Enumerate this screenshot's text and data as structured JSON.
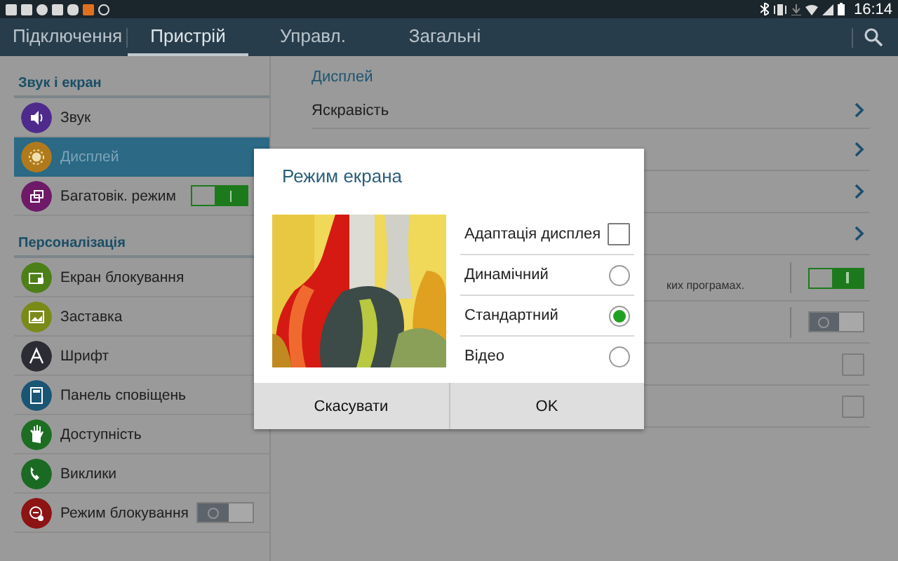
{
  "status_bar": {
    "time": "16:14"
  },
  "tabs": [
    {
      "label": "Підключення",
      "selected": false
    },
    {
      "label": "Пристрій",
      "selected": true
    },
    {
      "label": "Управл.",
      "selected": false
    },
    {
      "label": "Загальні",
      "selected": false
    }
  ],
  "sidebar": {
    "sections": [
      {
        "title": "Звук і екран",
        "items": [
          {
            "label": "Звук",
            "color": "#4e2a8c",
            "selected": false,
            "kind": "plain"
          },
          {
            "label": "Дисплей",
            "color": "#b07a1c",
            "selected": true,
            "kind": "plain"
          },
          {
            "label": "Багатовік. режим",
            "color": "#6e1a68",
            "selected": false,
            "kind": "toggle",
            "on": true
          }
        ]
      },
      {
        "title": "Персоналізація",
        "items": [
          {
            "label": "Екран блокування",
            "color": "#4d7f19",
            "selected": false,
            "kind": "plain"
          },
          {
            "label": "Заставка",
            "color": "#7a8a18",
            "selected": false,
            "kind": "plain"
          },
          {
            "label": "Шрифт",
            "color": "#2c2c34",
            "selected": false,
            "kind": "plain"
          },
          {
            "label": "Панель сповіщень",
            "color": "#1a5574",
            "selected": false,
            "kind": "plain"
          },
          {
            "label": "Доступність",
            "color": "#1d6e22",
            "selected": false,
            "kind": "plain"
          },
          {
            "label": "Виклики",
            "color": "#1b6a24",
            "selected": false,
            "kind": "plain"
          },
          {
            "label": "Режим блокування",
            "color": "#8c1414",
            "selected": false,
            "kind": "toggle",
            "on": false
          }
        ]
      }
    ]
  },
  "main": {
    "section_title": "Дисплей",
    "rows": [
      {
        "kind": "link",
        "label": "Яскравість"
      },
      {
        "kind": "link"
      },
      {
        "kind": "link"
      },
      {
        "kind": "link"
      },
      {
        "kind": "toggle",
        "on": true,
        "subtitle": "ких програмах."
      },
      {
        "kind": "toggle",
        "on": false
      },
      {
        "kind": "checkbox",
        "checked": false
      },
      {
        "kind": "checkbox",
        "checked": false
      }
    ]
  },
  "dialog": {
    "title": "Режим екрана",
    "options": [
      {
        "kind": "checkbox",
        "label": "Адаптація дисплея",
        "checked": false
      },
      {
        "kind": "radio",
        "label": "Динамічний",
        "selected": false
      },
      {
        "kind": "radio",
        "label": "Стандартний",
        "selected": true
      },
      {
        "kind": "radio",
        "label": "Відео",
        "selected": false
      }
    ],
    "buttons": [
      "Скасувати",
      "OK"
    ]
  }
}
